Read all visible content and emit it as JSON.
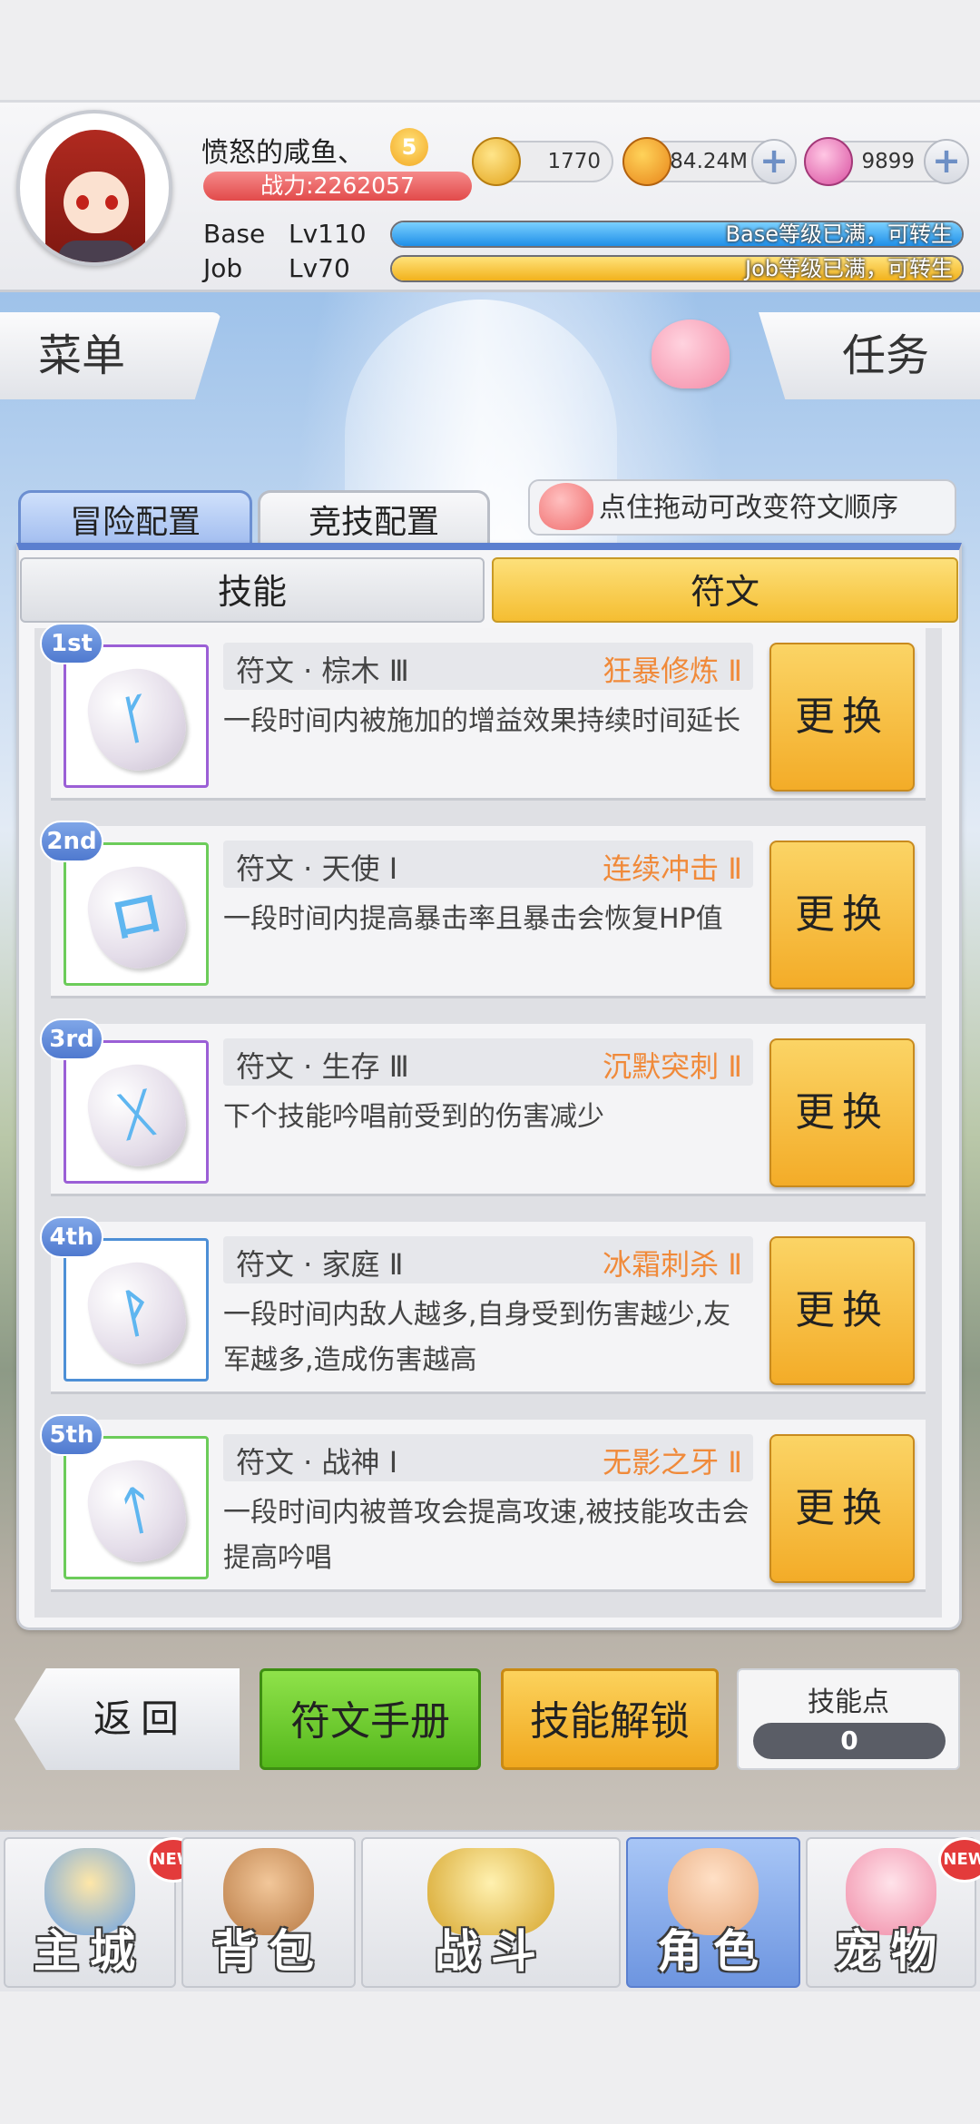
{
  "player": {
    "name": "愤怒的咸鱼、",
    "vip_level": "5",
    "power": "战力:2262057",
    "base_label": "Base",
    "base_level": "Lv110",
    "base_bar_text": "Base等级已满，可转生",
    "base_bar_progress": 1.0,
    "job_label": "Job",
    "job_level": "Lv70",
    "job_bar_text": "Job等级已满，可转生",
    "job_bar_progress": 1.0
  },
  "currency": {
    "zeny": "1770",
    "gold": "84.24M",
    "gem": "9899",
    "plus": "+"
  },
  "top_buttons": {
    "menu": "菜单",
    "quest": "任务"
  },
  "config_tabs": {
    "adventure": "冒险配置",
    "arena": "竞技配置"
  },
  "hint": "点住拖动可改变符文顺序",
  "sub_tabs": {
    "skills": "技能",
    "runes": "符文"
  },
  "runes": [
    {
      "rank": "1st",
      "name": "符文 · 棕木 Ⅲ",
      "skill": "狂暴修炼 Ⅱ",
      "desc": "一段时间内被施加的增益效果持续时间延长",
      "button": "更换",
      "glyph": "ᚴ",
      "frame_color": "#9b5fd6"
    },
    {
      "rank": "2nd",
      "name": "符文 · 天使 Ⅰ",
      "skill": "连续冲击 Ⅱ",
      "desc": "一段时间内提高暴击率且暴击会恢复HP值",
      "button": "更换",
      "glyph": "ロ",
      "frame_color": "#6ccc5a"
    },
    {
      "rank": "3rd",
      "name": "符文 · 生存 Ⅲ",
      "skill": "沉默突刺 Ⅱ",
      "desc": "下个技能吟唱前受到的伤害减少",
      "button": "更换",
      "glyph": "ᚷ",
      "frame_color": "#9b5fd6"
    },
    {
      "rank": "4th",
      "name": "符文 · 家庭 Ⅱ",
      "skill": "冰霜刺杀 Ⅱ",
      "desc": "一段时间内敌人越多,自身受到伤害越少,友军越多,造成伤害越高",
      "button": "更换",
      "glyph": "ᚹ",
      "frame_color": "#4d8fd6"
    },
    {
      "rank": "5th",
      "name": "符文 · 战神 Ⅰ",
      "skill": "无影之牙 Ⅱ",
      "desc": "一段时间内被普攻会提高攻速,被技能攻击会提高吟唱",
      "button": "更换",
      "glyph": "ᛏ",
      "frame_color": "#6ccc5a"
    }
  ],
  "actions": {
    "back": "返回",
    "rune_manual": "符文手册",
    "skill_unlock": "技能解锁",
    "skill_points_label": "技能点",
    "skill_points": "0"
  },
  "nav": [
    {
      "label": "主城",
      "badge": "NEW"
    },
    {
      "label": "背包",
      "badge": ""
    },
    {
      "label": "战斗",
      "badge": ""
    },
    {
      "label": "角色",
      "badge": ""
    },
    {
      "label": "宠物",
      "badge": "NEW"
    }
  ],
  "colors": {
    "accent_blue": "#5b7fcf",
    "button_yellow": "#f3ac28",
    "button_green": "#55b81c",
    "skill_orange": "#f08a3a",
    "power_red": "#e24a4a"
  }
}
